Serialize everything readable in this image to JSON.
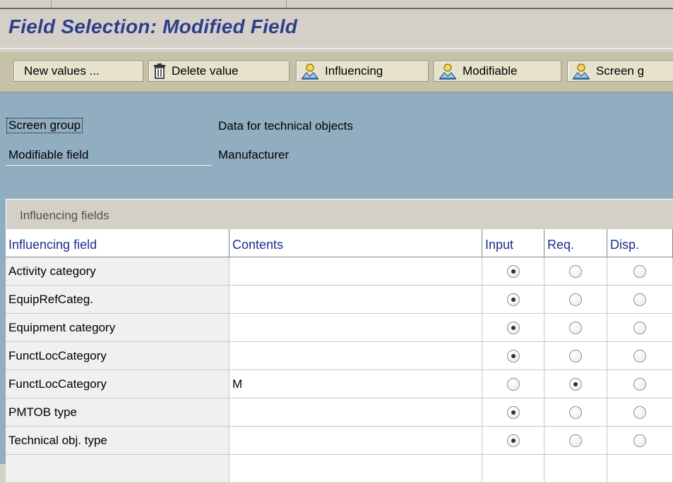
{
  "page": {
    "title": "Field Selection: Modified Field"
  },
  "toolbar": {
    "buttons": [
      {
        "label": "New values ...",
        "icon": ""
      },
      {
        "label": "Delete value",
        "icon": "trash-icon"
      },
      {
        "label": "Influencing",
        "icon": "user-icon"
      },
      {
        "label": "Modifiable",
        "icon": "user-icon"
      },
      {
        "label": "Screen g",
        "icon": "user-icon"
      }
    ]
  },
  "header": {
    "screen_group_label": "Screen group",
    "screen_group_value": "Data for technical objects",
    "modifiable_field_label": "Modifiable field",
    "modifiable_field_value": "Manufacturer"
  },
  "table": {
    "caption": "Influencing fields",
    "columns": [
      "Influencing field",
      "Contents",
      "Input",
      "Req.",
      "Disp."
    ],
    "rows": [
      {
        "field": "Activity category",
        "contents": "",
        "selected": "Input"
      },
      {
        "field": "EquipRefCateg.",
        "contents": "",
        "selected": "Input"
      },
      {
        "field": "Equipment category",
        "contents": "",
        "selected": "Input"
      },
      {
        "field": "FunctLocCategory",
        "contents": "",
        "selected": "Input"
      },
      {
        "field": "FunctLocCategory",
        "contents": "M",
        "selected": "Req."
      },
      {
        "field": "PMTOB type",
        "contents": "",
        "selected": "Input"
      },
      {
        "field": "Technical obj. type",
        "contents": "",
        "selected": "Input"
      },
      {
        "field": "",
        "contents": "",
        "selected": ""
      }
    ]
  },
  "colors": {
    "title": "#2c3f8c",
    "toolbar_bg": "#c6c2a7",
    "panel_bg": "#91adc0",
    "header_text": "#1d2f8c"
  }
}
